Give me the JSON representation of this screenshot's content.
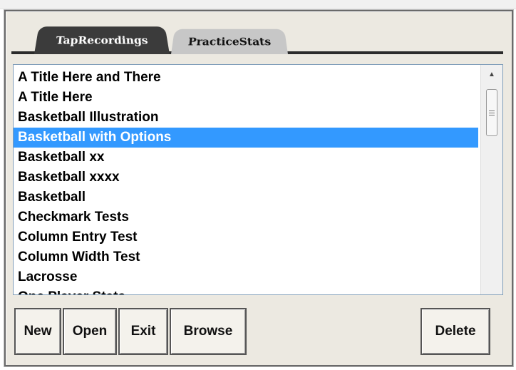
{
  "tabs": [
    {
      "label": "TapRecordings",
      "active": true
    },
    {
      "label": "PracticeStats",
      "active": false
    }
  ],
  "recordings": {
    "items": [
      "A Title Here and There",
      "A Title Here",
      "Basketball Illustration",
      "Basketball with Options",
      "Basketball xx",
      "Basketball xxxx",
      "Basketball",
      "Checkmark Tests",
      "Column Entry Test",
      "Column Width Test",
      "Lacrosse",
      "One Player Stats"
    ],
    "selected_index": 3
  },
  "buttons": {
    "new": "New",
    "open": "Open",
    "exit": "Exit",
    "browse": "Browse",
    "delete": "Delete"
  },
  "colors": {
    "selection": "#3399ff",
    "active_tab": "#3b3b3b",
    "inactive_tab": "#c7c7c7",
    "frame": "#ece9e1"
  },
  "icons": {
    "scroll_up": "scroll-up-arrow-icon",
    "scroll_grip": "scrollbar-grip-icon"
  }
}
